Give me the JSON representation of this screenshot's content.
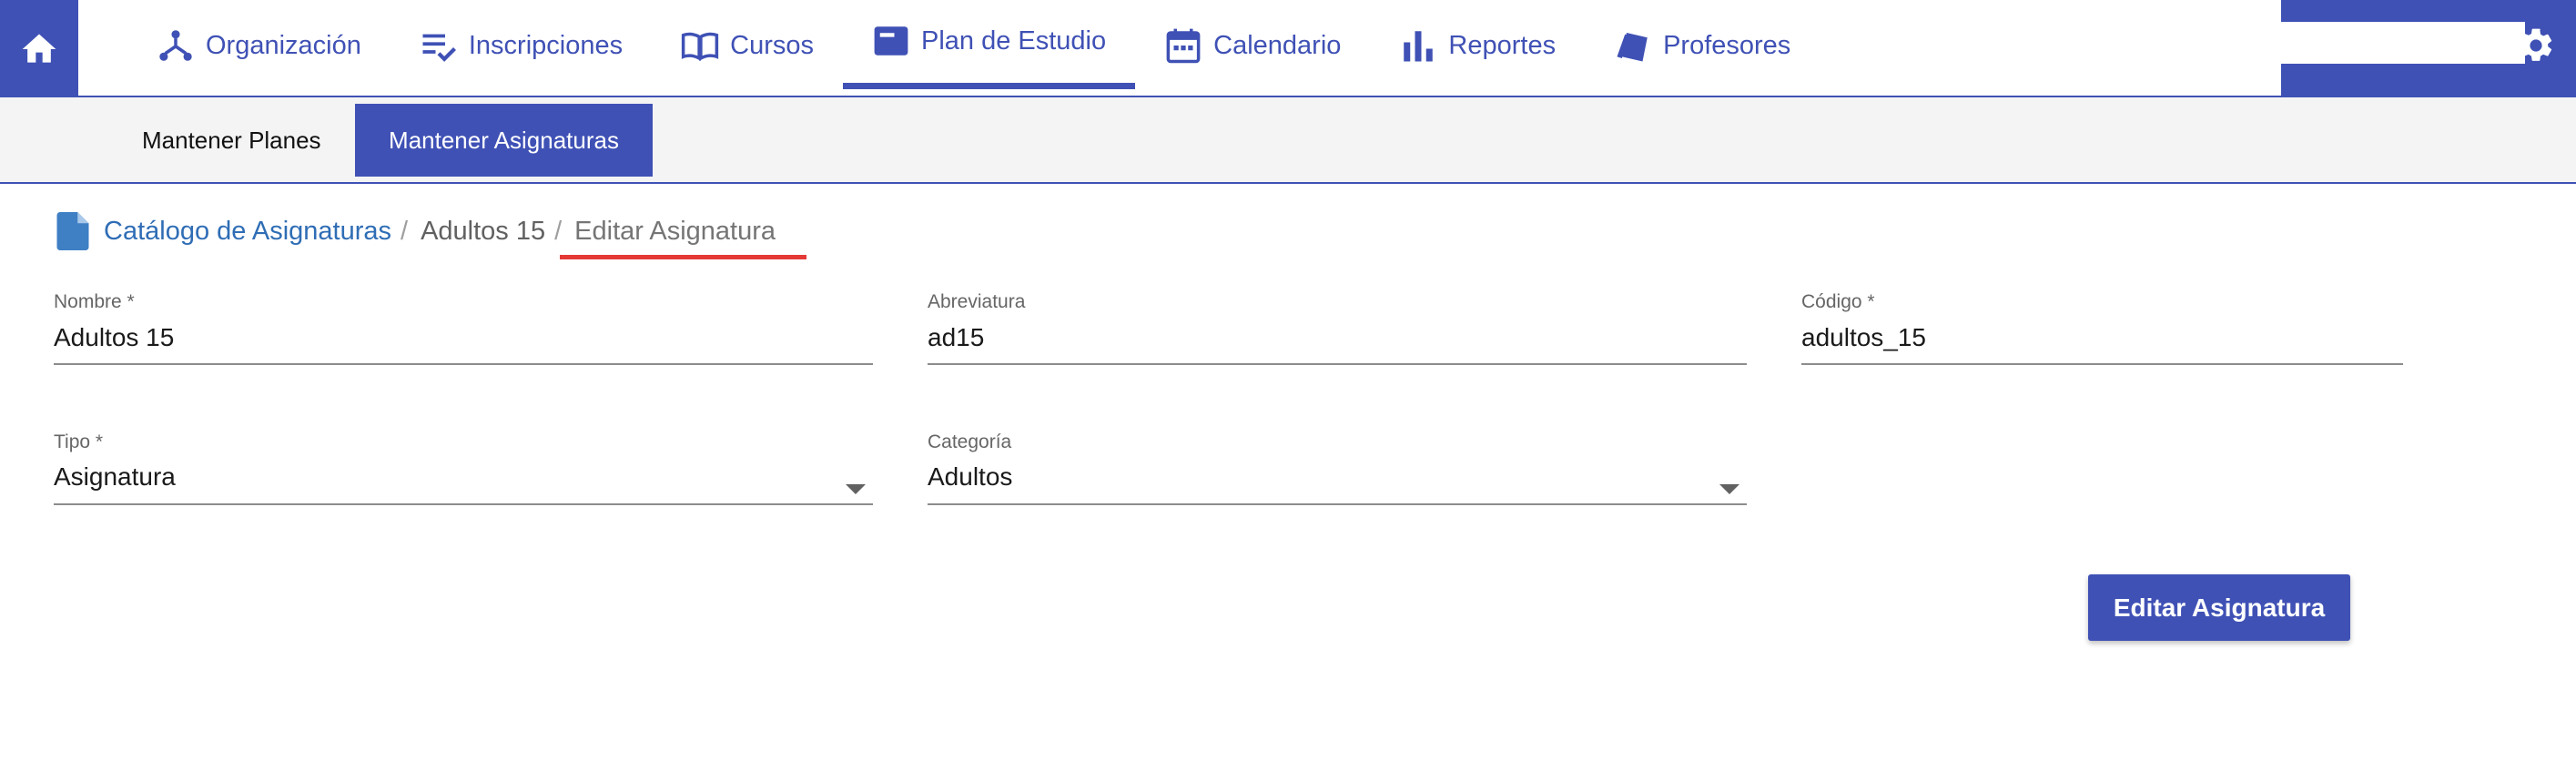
{
  "colors": {
    "primary": "#3f51b5",
    "link": "#2f6db5",
    "active_underline": "#e53935"
  },
  "topbar": {
    "home_icon": "home-icon",
    "nav": [
      {
        "label": "Organización",
        "icon": "organization-icon"
      },
      {
        "label": "Inscripciones",
        "icon": "checklist-icon"
      },
      {
        "label": "Cursos",
        "icon": "book-icon"
      },
      {
        "label": "Plan de Estudio",
        "icon": "card-icon",
        "active": true
      },
      {
        "label": "Calendario",
        "icon": "calendar-icon"
      },
      {
        "label": "Reportes",
        "icon": "bar-chart-icon"
      },
      {
        "label": "Profesores",
        "icon": "cards-icon"
      }
    ],
    "settings_icon": "gear-icon"
  },
  "subnav": {
    "tabs": [
      {
        "label": "Mantener Planes",
        "active": false
      },
      {
        "label": "Mantener Asignaturas",
        "active": true
      }
    ]
  },
  "breadcrumb": {
    "icon": "document-icon",
    "items": [
      "Catálogo de Asignaturas",
      "Adultos 15",
      "Editar Asignatura"
    ],
    "separator": "/"
  },
  "form": {
    "nombre": {
      "label": "Nombre *",
      "value": "Adultos 15"
    },
    "abreviatura": {
      "label": "Abreviatura",
      "value": "ad15"
    },
    "codigo": {
      "label": "Código *",
      "value": "adultos_15"
    },
    "tipo": {
      "label": "Tipo *",
      "value": "Asignatura"
    },
    "categoria": {
      "label": "Categoría",
      "value": "Adultos"
    },
    "submit_label": "Editar Asignatura"
  }
}
